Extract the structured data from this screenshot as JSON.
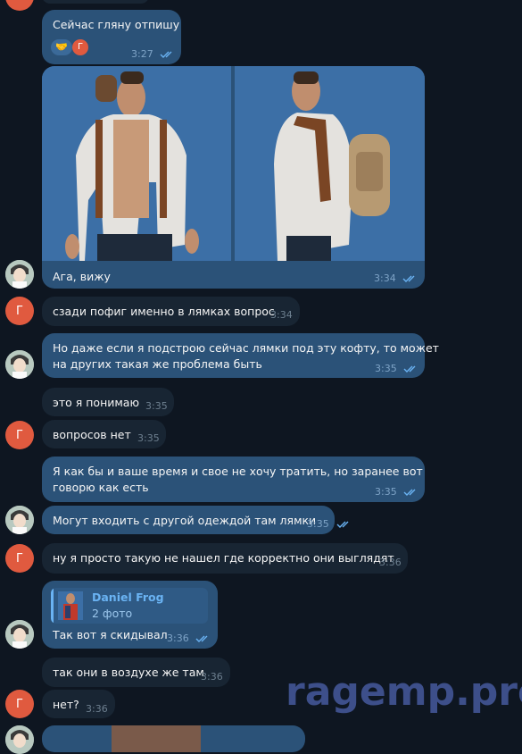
{
  "messages": {
    "m1": {
      "text": "Сейчас гляну отпишу",
      "time": "3:27",
      "reactions": [
        "handshake-emoji",
        "Г"
      ]
    },
    "m2": {
      "caption": "Ага, вижу",
      "time": "3:34"
    },
    "m3": {
      "text": "сзади пофиг именно в лямках вопрос",
      "time": "3:34"
    },
    "m4": {
      "line1": "Но даже если я подстрою сейчас лямки под эту кофту, то может",
      "line2": "на других такая же проблема быть",
      "time": "3:35"
    },
    "m5": {
      "text": "это я понимаю",
      "time": "3:35"
    },
    "m6": {
      "text": "вопросов нет",
      "time": "3:35"
    },
    "m7": {
      "line1": "Я как бы и ваше время и свое не хочу тратить, но заранее вот",
      "line2": "говорю как есть",
      "time": "3:35"
    },
    "m8": {
      "text": "Могут входить с другой одеждой там лямки",
      "time": "3:35"
    },
    "m9": {
      "text": "ну я просто такую не нашел где корректно они выглядят",
      "time": "3:36"
    },
    "m10": {
      "reply_author": "Daniel Frog",
      "reply_preview": "2 фото",
      "text": "Так вот я скидывал",
      "time": "3:36"
    },
    "m11": {
      "text": "так они в воздухе же там",
      "time": "3:36"
    },
    "m12": {
      "text": "нет?",
      "time": "3:36"
    }
  },
  "avatar_letter": "Г",
  "watermark": "ragemp.pro",
  "colors": {
    "background": "#0e1621",
    "outgoing": "#2b5278",
    "incoming": "#182533",
    "accent": "#6ab3f3",
    "avatar_letter_bg": "#e05a3f"
  }
}
